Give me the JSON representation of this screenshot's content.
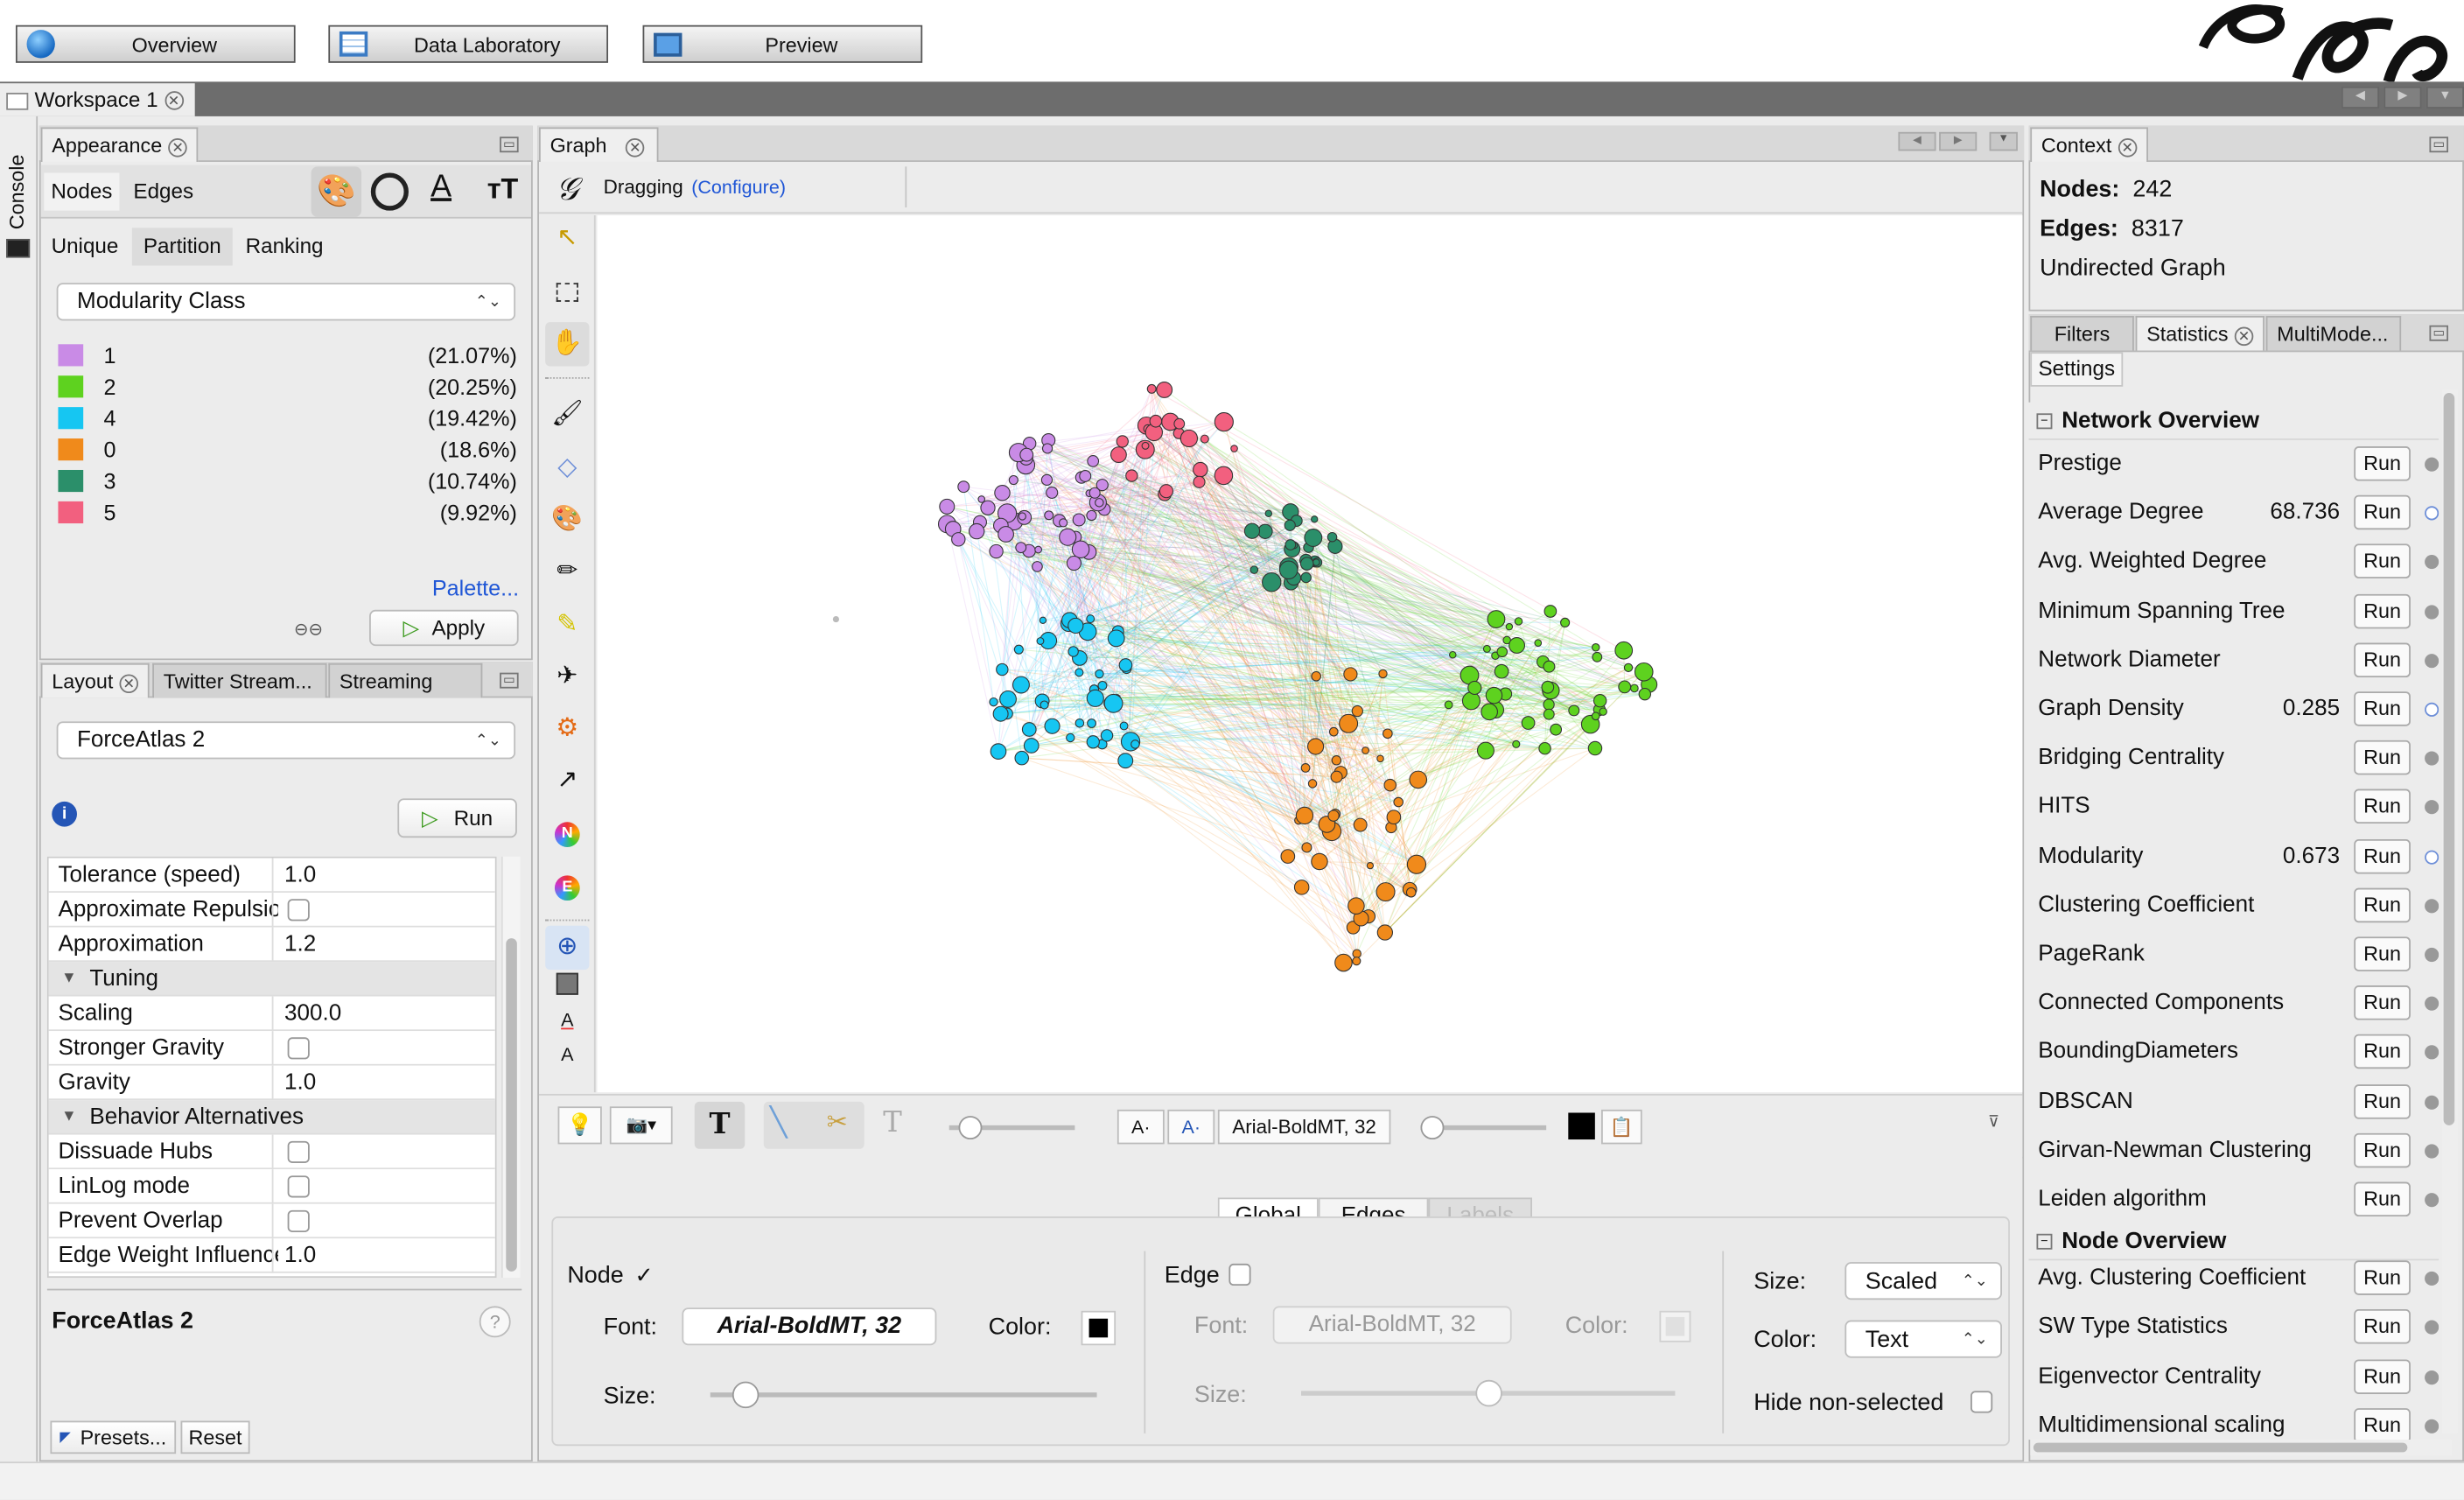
{
  "toolbar": {
    "overview": "Overview",
    "data_lab": "Data Laboratory",
    "preview": "Preview"
  },
  "workspace": {
    "tab": "Workspace 1"
  },
  "console": {
    "label": "Console"
  },
  "appearance": {
    "title": "Appearance",
    "tabs": [
      "Nodes",
      "Edges"
    ],
    "subtabs": [
      "Unique",
      "Partition",
      "Ranking"
    ],
    "attribute": "Modularity Class",
    "partitions": [
      {
        "label": "1",
        "pct": "(21.07%)",
        "color": "#c98be6"
      },
      {
        "label": "2",
        "pct": "(20.25%)",
        "color": "#5ed21f"
      },
      {
        "label": "4",
        "pct": "(19.42%)",
        "color": "#16c6f2"
      },
      {
        "label": "0",
        "pct": "(18.6%)",
        "color": "#f08a1b"
      },
      {
        "label": "3",
        "pct": "(10.74%)",
        "color": "#2b8f6a"
      },
      {
        "label": "5",
        "pct": "(9.92%)",
        "color": "#f2607f"
      }
    ],
    "palette": "Palette...",
    "apply": "Apply"
  },
  "layout": {
    "tabs": [
      "Layout",
      "Twitter Stream...",
      "Streaming"
    ],
    "algorithm": "ForceAtlas 2",
    "run": "Run",
    "props": [
      {
        "k": "Tolerance (speed)",
        "v": "1.0"
      },
      {
        "k": "Approximate Repulsion",
        "v": "",
        "check": true
      },
      {
        "k": "Approximation",
        "v": "1.2"
      },
      {
        "k": "Tuning",
        "section": true
      },
      {
        "k": "Scaling",
        "v": "300.0"
      },
      {
        "k": "Stronger Gravity",
        "v": "",
        "check": true
      },
      {
        "k": "Gravity",
        "v": "1.0"
      },
      {
        "k": "Behavior Alternatives",
        "section": true
      },
      {
        "k": "Dissuade Hubs",
        "v": "",
        "check": true
      },
      {
        "k": "LinLog mode",
        "v": "",
        "check": true
      },
      {
        "k": "Prevent Overlap",
        "v": "",
        "check": true
      },
      {
        "k": "Edge Weight Influence",
        "v": "1.0"
      }
    ],
    "desc_title": "ForceAtlas 2",
    "presets": "Presets...",
    "reset": "Reset"
  },
  "graph": {
    "tab": "Graph",
    "mode": "Dragging",
    "configure": "(Configure)",
    "font_label": "Arial-BoldMT, 32"
  },
  "labels_panel": {
    "tabs": [
      "Global",
      "Edges",
      "Labels"
    ],
    "node_label": "Node",
    "font": "Font:",
    "node_font": "Arial-BoldMT, 32",
    "color": "Color:",
    "size": "Size:",
    "edge_label": "Edge",
    "edge_font": "Arial-BoldMT, 32",
    "size_label": "Size:",
    "size_value": "Scaled",
    "color_label": "Color:",
    "color_value": "Text",
    "hide": "Hide non-selected"
  },
  "context": {
    "title": "Context",
    "nodes_label": "Nodes:",
    "nodes": "242",
    "edges_label": "Edges:",
    "edges": "8317",
    "type": "Undirected Graph"
  },
  "stats": {
    "tabs": [
      "Filters",
      "Statistics",
      "MultiMode..."
    ],
    "settings": "Settings",
    "network_overview": "Network Overview",
    "node_overview": "Node Overview",
    "run": "Run",
    "network": [
      {
        "name": "Prestige",
        "value": ""
      },
      {
        "name": "Average Degree",
        "value": "68.736"
      },
      {
        "name": "Avg. Weighted Degree",
        "value": ""
      },
      {
        "name": "Minimum Spanning Tree",
        "value": ""
      },
      {
        "name": "Network Diameter",
        "value": ""
      },
      {
        "name": "Graph Density",
        "value": "0.285"
      },
      {
        "name": "Bridging Centrality",
        "value": ""
      },
      {
        "name": "HITS",
        "value": ""
      },
      {
        "name": "Modularity",
        "value": "0.673"
      },
      {
        "name": "Clustering Coefficient",
        "value": ""
      },
      {
        "name": "PageRank",
        "value": ""
      },
      {
        "name": "Connected Components",
        "value": ""
      },
      {
        "name": "BoundingDiameters",
        "value": ""
      },
      {
        "name": "DBSCAN",
        "value": ""
      },
      {
        "name": "Girvan-Newman Clustering",
        "value": ""
      },
      {
        "name": "Leiden algorithm",
        "value": ""
      }
    ],
    "node": [
      {
        "name": "Avg. Clustering Coefficient",
        "value": ""
      },
      {
        "name": "SW Type Statistics",
        "value": ""
      },
      {
        "name": "Eigenvector Centrality",
        "value": ""
      },
      {
        "name": "Multidimensional scaling",
        "value": ""
      }
    ]
  }
}
